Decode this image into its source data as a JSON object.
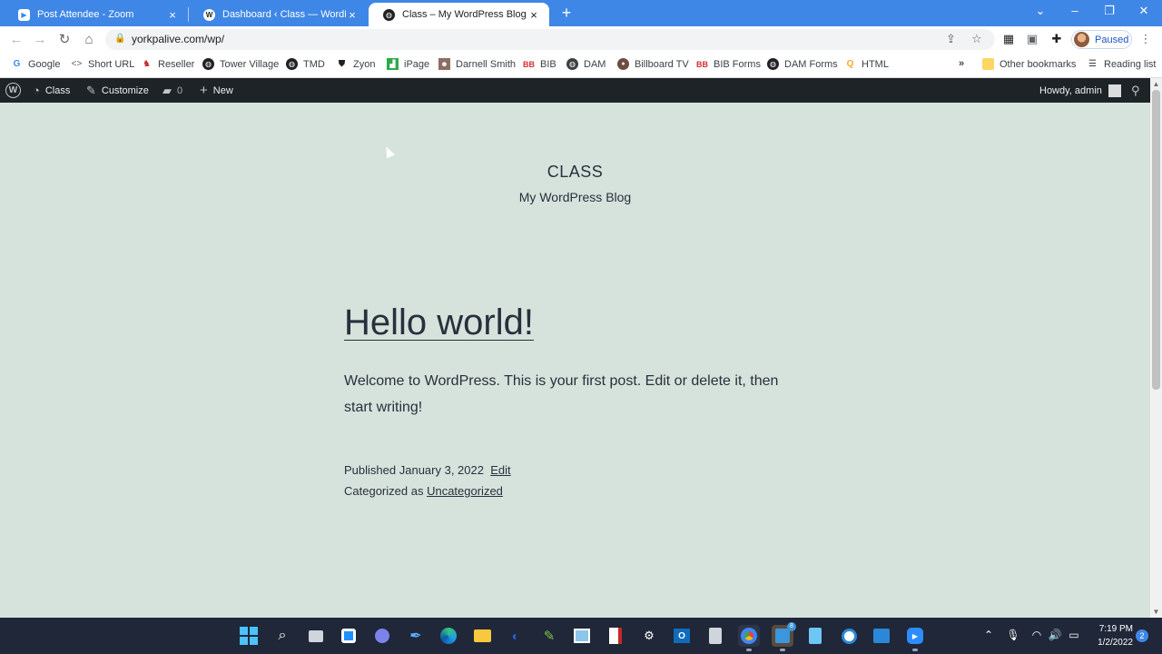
{
  "browser": {
    "tabs": [
      {
        "title": "Post Attendee - Zoom",
        "icon": "zoom-icon",
        "active": false
      },
      {
        "title": "Dashboard ‹ Class — WordPress",
        "icon": "wordpress-icon",
        "active": false
      },
      {
        "title": "Class – My WordPress Blog",
        "icon": "globe-icon",
        "active": true
      }
    ],
    "url": "yorkpalive.com/wp/",
    "profile_status": "Paused",
    "bookmarks": [
      {
        "label": "Google",
        "icon": "google-icon"
      },
      {
        "label": "Short URL",
        "icon": "code-icon"
      },
      {
        "label": "Reseller",
        "icon": "reseller-icon"
      },
      {
        "label": "Tower Village",
        "icon": "globe-icon"
      },
      {
        "label": "TMD",
        "icon": "globe-icon"
      },
      {
        "label": "Zyon",
        "icon": "shield-icon"
      },
      {
        "label": "iPage",
        "icon": "ipage-icon"
      },
      {
        "label": "Darnell Smith",
        "icon": "person-icon"
      },
      {
        "label": "BIB",
        "icon": "bib-icon"
      },
      {
        "label": "DAM",
        "icon": "globe-icon"
      },
      {
        "label": "Billboard TV",
        "icon": "billboard-icon"
      },
      {
        "label": "BIB Forms",
        "icon": "bib-icon"
      },
      {
        "label": "DAM Forms",
        "icon": "globe-icon"
      },
      {
        "label": "HTML",
        "icon": "search-icon"
      }
    ],
    "other_bookmarks": "Other bookmarks",
    "reading_list": "Reading list"
  },
  "adminbar": {
    "site_name": "Class",
    "customize": "Customize",
    "comments_count": "0",
    "new": "New",
    "howdy": "Howdy, admin"
  },
  "site": {
    "title": "CLASS",
    "description": "My WordPress Blog"
  },
  "post": {
    "title": "Hello world!",
    "body": "Welcome to WordPress. This is your first post. Edit or delete it, then start writing!",
    "published_label": "Published",
    "published_date": "January 3, 2022",
    "edit_label": "Edit",
    "categorized_label": "Categorized as",
    "category": "Uncategorized"
  },
  "taskbar": {
    "time": "7:19 PM",
    "date": "1/2/2022",
    "notifications": "2",
    "apps_badge": "8"
  },
  "colors": {
    "tab_strip": "#3f87e6",
    "admin_bar": "#1d2327",
    "page_background": "#d6e3dc",
    "text": "#28303d",
    "taskbar": "#1f2738"
  }
}
